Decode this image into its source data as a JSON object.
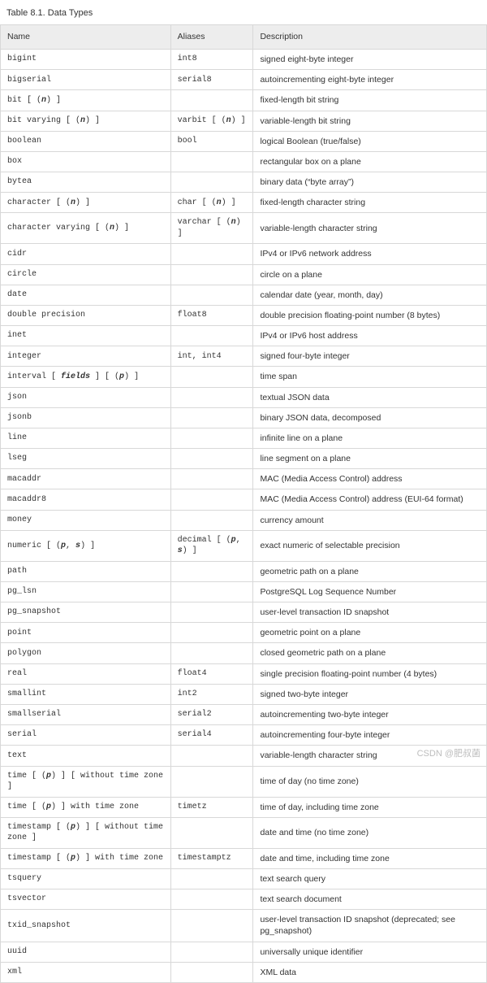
{
  "caption": "Table 8.1. Data Types",
  "columns": [
    "Name",
    "Aliases",
    "Description"
  ],
  "rows": [
    {
      "name": "bigint",
      "aliases": "int8",
      "desc": "signed eight-byte integer"
    },
    {
      "name": "bigserial",
      "aliases": "serial8",
      "desc": "autoincrementing eight-byte integer"
    },
    {
      "name": "bit [ (<i>n</i>) ]",
      "aliases": "",
      "desc": "fixed-length bit string"
    },
    {
      "name": "bit varying [ (<i>n</i>) ]",
      "aliases": "varbit [ (<i>n</i>) ]",
      "desc": "variable-length bit string"
    },
    {
      "name": "boolean",
      "aliases": "bool",
      "desc": "logical Boolean (true/false)"
    },
    {
      "name": "box",
      "aliases": "",
      "desc": "rectangular box on a plane"
    },
    {
      "name": "bytea",
      "aliases": "",
      "desc": "binary data (“byte array”)"
    },
    {
      "name": "character [ (<i>n</i>) ]",
      "aliases": "char [ (<i>n</i>) ]",
      "desc": "fixed-length character string"
    },
    {
      "name": "character varying [ (<i>n</i>) ]",
      "aliases": "varchar [ (<i>n</i>) ]",
      "desc": "variable-length character string"
    },
    {
      "name": "cidr",
      "aliases": "",
      "desc": "IPv4 or IPv6 network address"
    },
    {
      "name": "circle",
      "aliases": "",
      "desc": "circle on a plane"
    },
    {
      "name": "date",
      "aliases": "",
      "desc": "calendar date (year, month, day)"
    },
    {
      "name": "double precision",
      "aliases": "float8",
      "desc": "double precision floating-point number (8 bytes)"
    },
    {
      "name": "inet",
      "aliases": "",
      "desc": "IPv4 or IPv6 host address"
    },
    {
      "name": "integer",
      "aliases": "int, int4",
      "desc": "signed four-byte integer"
    },
    {
      "name": "interval [ <i>fields</i> ] [ (<i>p</i>) ]",
      "aliases": "",
      "desc": "time span"
    },
    {
      "name": "json",
      "aliases": "",
      "desc": "textual JSON data"
    },
    {
      "name": "jsonb",
      "aliases": "",
      "desc": "binary JSON data, decomposed"
    },
    {
      "name": "line",
      "aliases": "",
      "desc": "infinite line on a plane"
    },
    {
      "name": "lseg",
      "aliases": "",
      "desc": "line segment on a plane"
    },
    {
      "name": "macaddr",
      "aliases": "",
      "desc": "MAC (Media Access Control) address"
    },
    {
      "name": "macaddr8",
      "aliases": "",
      "desc": "MAC (Media Access Control) address (EUI-64 format)"
    },
    {
      "name": "money",
      "aliases": "",
      "desc": "currency amount"
    },
    {
      "name": "numeric [ (<i>p</i>, <i>s</i>) ]",
      "aliases": "decimal [ (<i>p</i>, <i>s</i>) ]",
      "desc": "exact numeric of selectable precision"
    },
    {
      "name": "path",
      "aliases": "",
      "desc": "geometric path on a plane"
    },
    {
      "name": "pg_lsn",
      "aliases": "",
      "desc": "PostgreSQL Log Sequence Number"
    },
    {
      "name": "pg_snapshot",
      "aliases": "",
      "desc": "user-level transaction ID snapshot"
    },
    {
      "name": "point",
      "aliases": "",
      "desc": "geometric point on a plane"
    },
    {
      "name": "polygon",
      "aliases": "",
      "desc": "closed geometric path on a plane"
    },
    {
      "name": "real",
      "aliases": "float4",
      "desc": "single precision floating-point number (4 bytes)"
    },
    {
      "name": "smallint",
      "aliases": "int2",
      "desc": "signed two-byte integer"
    },
    {
      "name": "smallserial",
      "aliases": "serial2",
      "desc": "autoincrementing two-byte integer"
    },
    {
      "name": "serial",
      "aliases": "serial4",
      "desc": "autoincrementing four-byte integer"
    },
    {
      "name": "text",
      "aliases": "",
      "desc": "variable-length character string"
    },
    {
      "name": "time [ (<i>p</i>) ] [ without time zone ]",
      "aliases": "",
      "desc": "time of day (no time zone)"
    },
    {
      "name": "time [ (<i>p</i>) ] with time zone",
      "aliases": "timetz",
      "desc": "time of day, including time zone"
    },
    {
      "name": "timestamp [ (<i>p</i>) ] [ without time zone ]",
      "aliases": "",
      "desc": "date and time (no time zone)"
    },
    {
      "name": "timestamp [ (<i>p</i>) ] with time zone",
      "aliases": "timestamptz",
      "desc": "date and time, including time zone"
    },
    {
      "name": "tsquery",
      "aliases": "",
      "desc": "text search query"
    },
    {
      "name": "tsvector",
      "aliases": "",
      "desc": "text search document"
    },
    {
      "name": "txid_snapshot",
      "aliases": "",
      "desc": "user-level transaction ID snapshot (deprecated; see pg_snapshot)"
    },
    {
      "name": "uuid",
      "aliases": "",
      "desc": "universally unique identifier"
    },
    {
      "name": "xml",
      "aliases": "",
      "desc": "XML data"
    }
  ],
  "watermark": "CSDN @肥叔菌"
}
